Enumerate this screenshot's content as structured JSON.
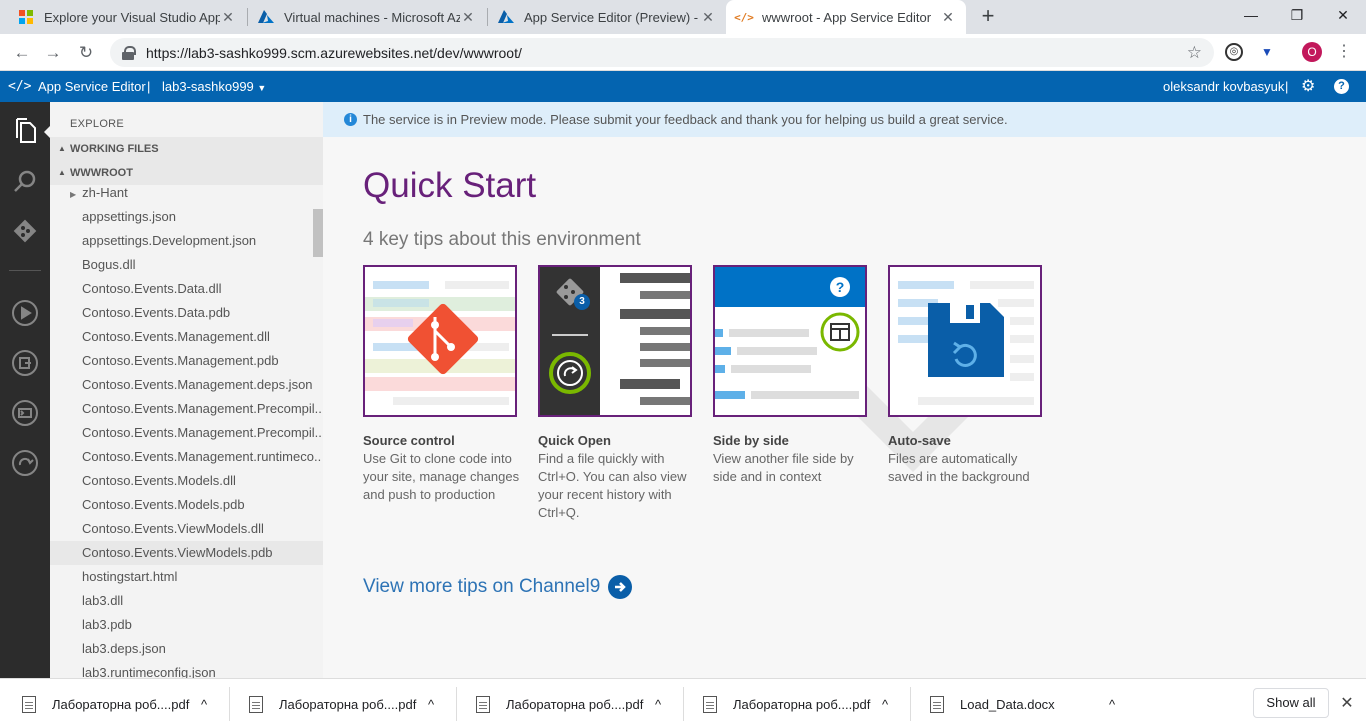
{
  "browser": {
    "tabs": [
      {
        "title": "Explore your Visual Studio App P",
        "icon": "windows-logo-icon"
      },
      {
        "title": "Virtual machines - Microsoft Azu",
        "icon": "azure-icon"
      },
      {
        "title": "App Service Editor (Preview) - M",
        "icon": "azure-icon"
      },
      {
        "title": "wwwroot - App Service Editor",
        "icon": "code-icon"
      }
    ],
    "url": "https://lab3-sashko999.scm.azurewebsites.net/dev/wwwroot/",
    "profile_initial": "O"
  },
  "appbar": {
    "title": "App Service Editor",
    "separator": "|",
    "site": "lab3-sashko999",
    "user": "oleksandr kovbasyuk"
  },
  "sidebar": {
    "header": "EXPLORE",
    "working_files": "WORKING FILES",
    "root": "WWWROOT",
    "folder": "zh-Hant",
    "files": [
      "appsettings.json",
      "appsettings.Development.json",
      "Bogus.dll",
      "Contoso.Events.Data.dll",
      "Contoso.Events.Data.pdb",
      "Contoso.Events.Management.dll",
      "Contoso.Events.Management.pdb",
      "Contoso.Events.Management.deps.json",
      "Contoso.Events.Management.Precompil...",
      "Contoso.Events.Management.Precompil...",
      "Contoso.Events.Management.runtimeco...",
      "Contoso.Events.Models.dll",
      "Contoso.Events.Models.pdb",
      "Contoso.Events.ViewModels.dll",
      "Contoso.Events.ViewModels.pdb",
      "hostingstart.html",
      "lab3.dll",
      "lab3.pdb",
      "lab3.deps.json",
      "lab3.runtimeconfig.json"
    ]
  },
  "banner": "The service is in Preview mode. Please submit your feedback and thank you for helping us build a great service.",
  "quickstart": {
    "title": "Quick Start",
    "subtitle": "4 key tips about this environment",
    "cards": [
      {
        "title": "Source control",
        "text": "Use Git to clone code into your site, manage changes and push to production"
      },
      {
        "title": "Quick Open",
        "text": "Find a file quickly with Ctrl+O. You can also view your recent history with Ctrl+Q."
      },
      {
        "title": "Side by side",
        "text": "View another file side by side and in context"
      },
      {
        "title": "Auto-save",
        "text": "Files are automatically saved in the background"
      }
    ],
    "badge": "3",
    "more_link": "View more tips on Channel9"
  },
  "downloads": {
    "items": [
      "Лабораторна роб....pdf",
      "Лабораторна роб....pdf",
      "Лабораторна роб....pdf",
      "Лабораторна роб....pdf",
      "Load_Data.docx"
    ],
    "show_all": "Show all"
  },
  "colors": {
    "accent": "#68217a",
    "appbar": "#0464b0",
    "git": "#f05133",
    "quickopen_ring": "#7ab800"
  }
}
